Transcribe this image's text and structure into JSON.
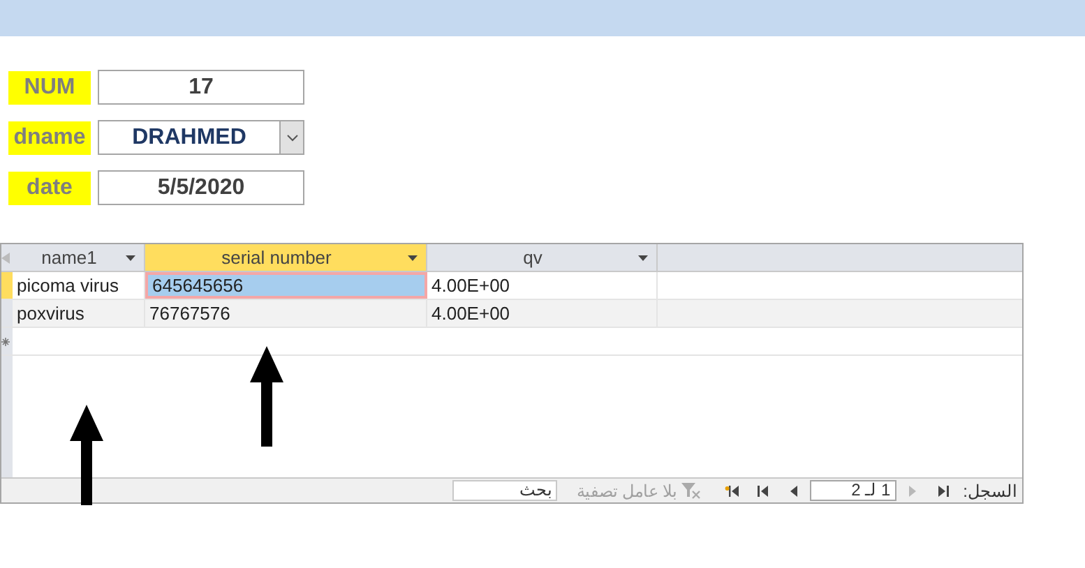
{
  "form_fields": [
    {
      "label": "NUM",
      "value": "17",
      "kind": "text"
    },
    {
      "label": "dname",
      "value": "DRAHMED",
      "kind": "combo"
    },
    {
      "label": "date",
      "value": "5/5/2020",
      "kind": "text"
    }
  ],
  "table": {
    "columns": [
      {
        "label": "name1",
        "selected": false
      },
      {
        "label": "serial number",
        "selected": true
      },
      {
        "label": "qv",
        "selected": false
      }
    ],
    "rows": [
      {
        "selected": true,
        "cells": [
          {
            "text": "picoma virus",
            "selected": false
          },
          {
            "text": "645645656",
            "selected": true
          },
          {
            "text": "4.00E+00",
            "selected": false
          }
        ]
      },
      {
        "selected": false,
        "cells": [
          {
            "text": "poxvirus",
            "selected": false
          },
          {
            "text": "76767576",
            "selected": false
          },
          {
            "text": "4.00E+00",
            "selected": false
          }
        ]
      }
    ]
  },
  "navigation": {
    "label": "السجل:",
    "buttons": [
      {
        "kind": "first",
        "disabled": false
      },
      {
        "kind": "prev",
        "disabled": true
      }
    ],
    "position": "1 لـ 2",
    "after_buttons": [
      {
        "kind": "next",
        "disabled": false
      },
      {
        "kind": "last",
        "disabled": false
      },
      {
        "kind": "new",
        "disabled": false
      }
    ],
    "filter": "بلا عامل تصفية",
    "search": "بحث"
  }
}
